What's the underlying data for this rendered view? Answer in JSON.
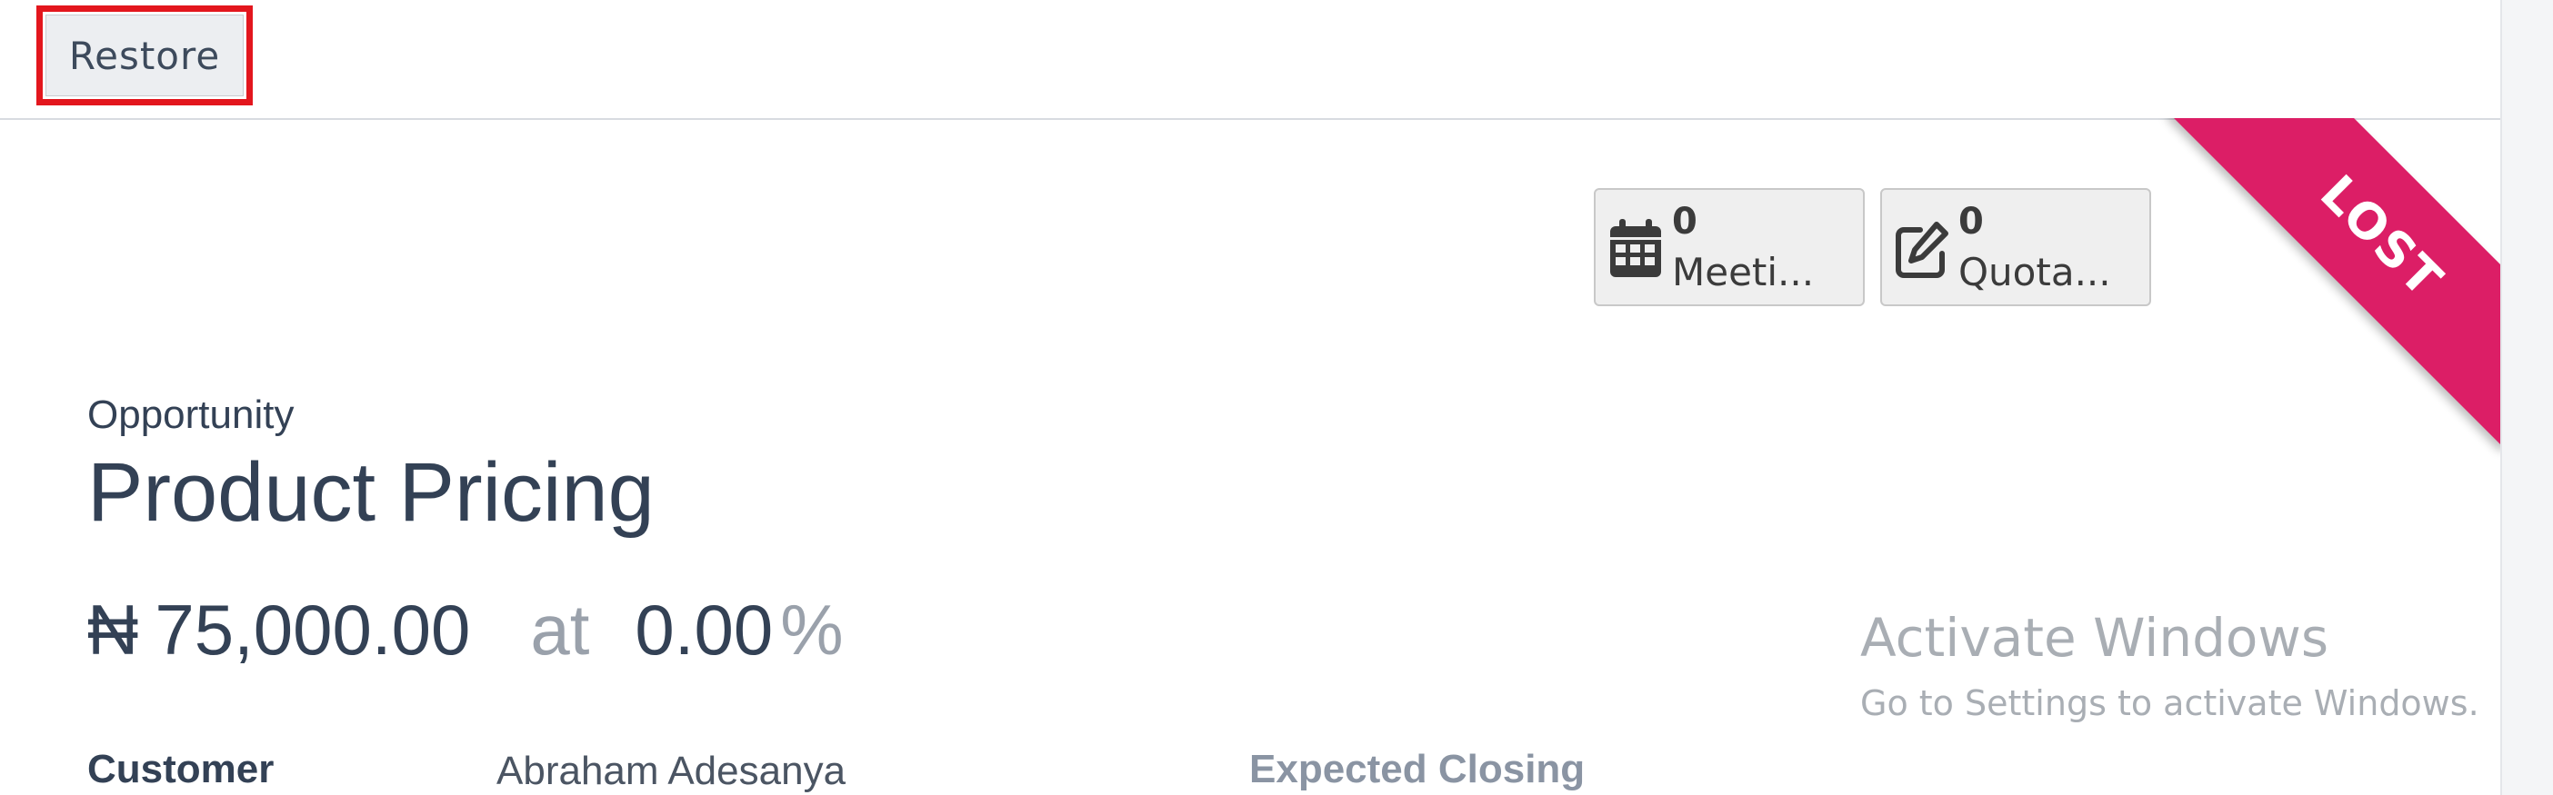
{
  "toolbar": {
    "restore_label": "Restore"
  },
  "smart_buttons": [
    {
      "count": "0",
      "label": "Meeti...",
      "icon": "calendar-icon"
    },
    {
      "count": "0",
      "label": "Quota...",
      "icon": "edit-icon"
    }
  ],
  "ribbon": {
    "label": "LOST",
    "color": "#dc1e66"
  },
  "record": {
    "kind": "Opportunity",
    "title": "Product Pricing",
    "currency_symbol": "₦",
    "expected_revenue": "75,000.00",
    "at_label": "at",
    "probability": "0.00",
    "percent_sign": "%"
  },
  "fields": {
    "customer_label": "Customer",
    "customer_value": "Abraham Adesanya",
    "expected_closing_label": "Expected Closing"
  },
  "watermark": {
    "title": "Activate Windows",
    "subtitle": "Go to Settings to activate Windows."
  }
}
